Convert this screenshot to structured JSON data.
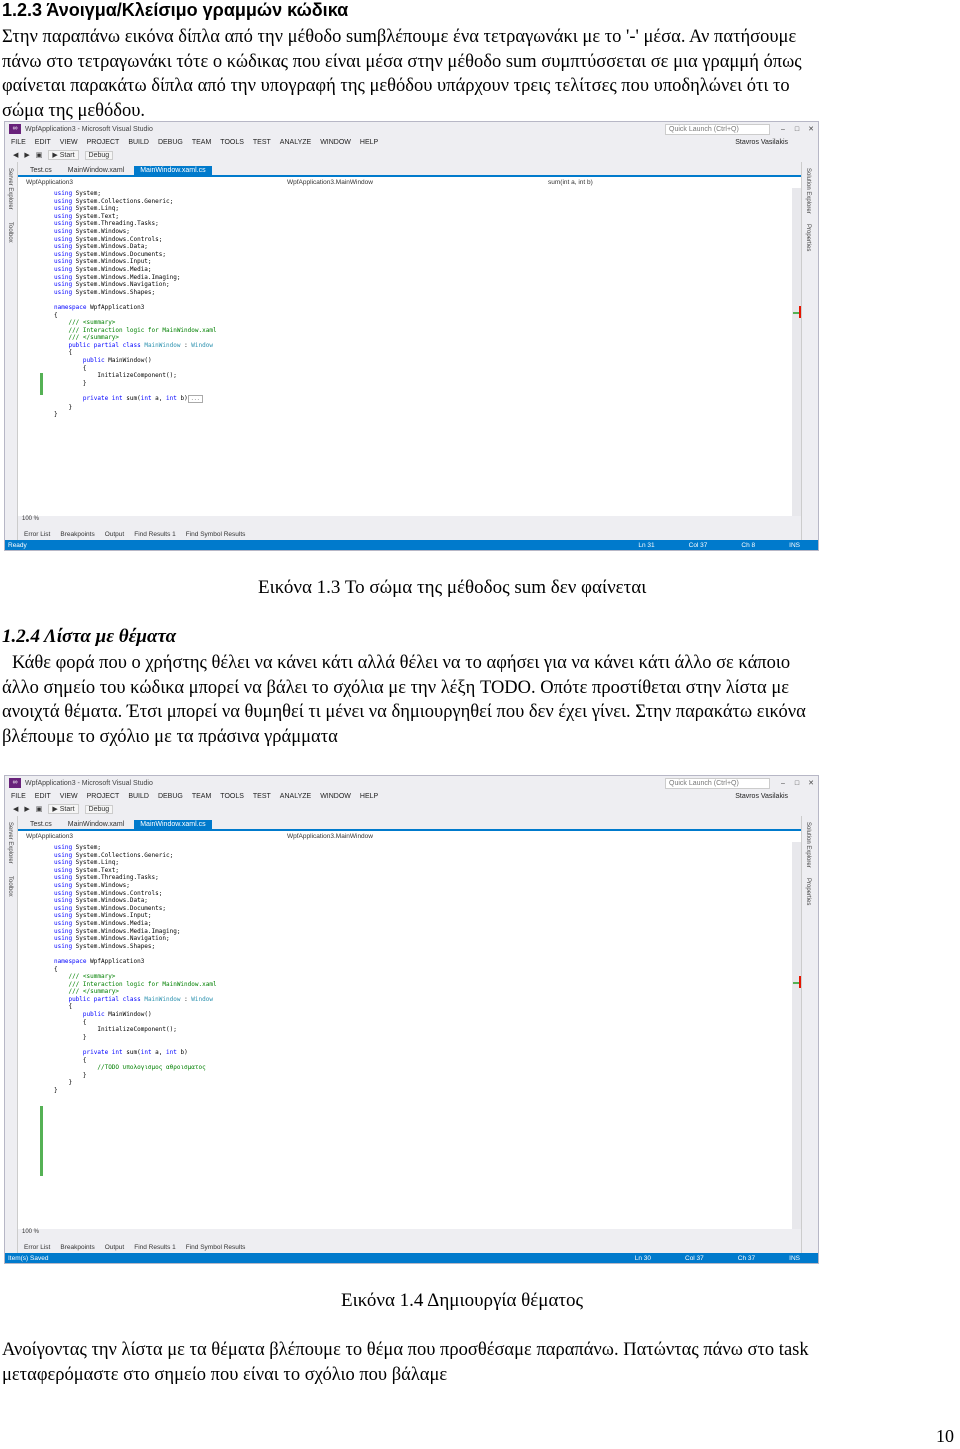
{
  "section1": {
    "heading": "1.2.3 Άνοιγμα/Κλείσιμο γραμμών κώδικα",
    "lines": [
      "Στην παραπάνω εικόνα δίπλα από την μέθοδο sumβλέπουμε ένα τετραγωνάκι με το '-' μέσα. Αν πατήσουμε",
      "πάνω στο τετραγωνάκι τότε ο κώδικας που είναι μέσα στην μέθοδο sum συμπτύσσεται σε μια γραμμή όπως",
      "φαίνεται παρακάτω δίπλα από την υπογραφή της μεθόδου υπάρχουν τρεις τελίτσες που υποδηλώνει ότι το",
      "σώμα της μεθόδου."
    ]
  },
  "figure1": {
    "caption": "Εικόνα 1.3 Το σώμα της μέθοδος sum δεν φαίνεται",
    "title": "WpfApplication3 - Microsoft Visual Studio",
    "quick_launch": "Quick Launch (Ctrl+Q)",
    "menu": [
      "FILE",
      "EDIT",
      "VIEW",
      "PROJECT",
      "BUILD",
      "DEBUG",
      "TEAM",
      "TOOLS",
      "TEST",
      "ANALYZE",
      "WINDOW",
      "HELP"
    ],
    "user": "Stavros Vasilakis",
    "start": "▶ Start",
    "config": "Debug",
    "left_side": [
      "Server Explorer",
      "Toolbox"
    ],
    "right_side": [
      "Solution Explorer",
      "Properties"
    ],
    "tabs": [
      "Test.cs",
      "MainWindow.xaml",
      "MainWindow.xaml.cs"
    ],
    "nav": [
      "WpfApplication3",
      "WpfApplication3.MainWindow",
      "sum(int a, int b)"
    ],
    "zoom": "100 %",
    "bottom_tabs": [
      "Error List",
      "Breakpoints",
      "Output",
      "Find Results 1",
      "Find Symbol Results"
    ],
    "status": {
      "left": "Ready",
      "ln": "Ln 31",
      "col": "Col 37",
      "ch": "Ch 8",
      "ins": "INS"
    }
  },
  "section2": {
    "heading": "1.2.4 Λίστα με θέματα",
    "lines": [
      "Κάθε φορά που ο χρήστης θέλει να κάνει κάτι αλλά θέλει να το αφήσει για να κάνει κάτι άλλο σε κάποιο",
      "άλλο σημείο του κώδικα μπορεί να βάλει το σχόλια με την λέξη TODO. Οπότε προστίθεται στην λίστα με",
      "ανοιχτά θέματα. Έτσι μπορεί να θυμηθεί τι μένει να δημιουργηθεί που δεν έχει γίνει. Στην παρακάτω εικόνα",
      "βλέπουμε το σχόλιο με τα πράσινα γράμματα"
    ]
  },
  "figure2": {
    "caption": "Εικόνα 1.4 Δημιουργία θέματος",
    "title": "WpfApplication3 - Microsoft Visual Studio",
    "quick_launch": "Quick Launch (Ctrl+Q)",
    "menu": [
      "FILE",
      "EDIT",
      "VIEW",
      "PROJECT",
      "BUILD",
      "DEBUG",
      "TEAM",
      "TOOLS",
      "TEST",
      "ANALYZE",
      "WINDOW",
      "HELP"
    ],
    "user": "Stavros Vasilakis",
    "start": "▶ Start",
    "config": "Debug",
    "left_side": [
      "Server Explorer",
      "Toolbox"
    ],
    "right_side": [
      "Solution Explorer",
      "Properties"
    ],
    "tabs": [
      "Test.cs",
      "MainWindow.xaml",
      "MainWindow.xaml.cs"
    ],
    "nav": [
      "WpfApplication3",
      "WpfApplication3.MainWindow",
      ""
    ],
    "zoom": "100 %",
    "bottom_tabs": [
      "Error List",
      "Breakpoints",
      "Output",
      "Find Results 1",
      "Find Symbol Results"
    ],
    "status": {
      "left": "Item(s) Saved",
      "ln": "Ln 30",
      "col": "Col 37",
      "ch": "Ch 37",
      "ins": "INS"
    },
    "todo_comment": "//TODO υπολογισμος αθροισματος"
  },
  "section3": {
    "lines": [
      "Ανοίγοντας την λίστα με τα θέματα βλέπουμε το θέμα που προσθέσαμε παραπάνω. Πατώντας πάνω στο task",
      "μεταφερόμαστε στο σημείο που είναι το σχόλιο που βάλαμε"
    ]
  },
  "page_number": "10"
}
